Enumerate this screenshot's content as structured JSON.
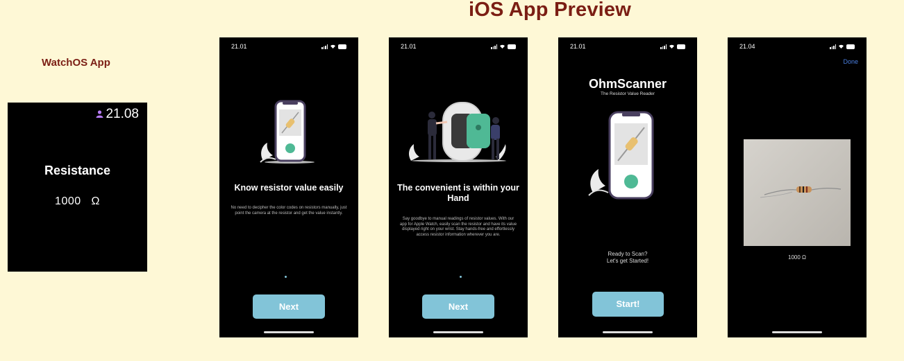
{
  "page": {
    "title": "iOS App Preview"
  },
  "watch": {
    "label": "WatchOS App",
    "time": "21.08",
    "heading": "Resistance",
    "value": "1000",
    "unit": "Ω"
  },
  "phones": [
    {
      "status_time": "21.01",
      "headline": "Know resistor value easily",
      "body": "No need to decipher the color codes on resistors manually, just point the camera at the resistor and get the value instantly.",
      "button": "Next"
    },
    {
      "status_time": "21.01",
      "headline": "The convenient is within your Hand",
      "body": "Say goodbye to manual readings of resistor values. With our app for Apple Watch, easily scan the resistor and have its value displayed right on your wrist. Stay hands-free and effortlessly access resistor information wherever you are.",
      "button": "Next"
    },
    {
      "status_time": "21.01",
      "app_name": "OhmScanner",
      "tagline": "The Resistor Value Reader",
      "prompt_line1": "Ready to Scan?",
      "prompt_line2": "Let's get Started!",
      "button": "Start!"
    },
    {
      "status_time": "21.04",
      "done": "Done",
      "reading": "1000 Ω"
    }
  ],
  "colors": {
    "background": "#fef8d6",
    "title": "#7b1e14",
    "button": "#82c4d8",
    "accent_green": "#4fb995",
    "watch_person_icon": "#b77cf6"
  }
}
